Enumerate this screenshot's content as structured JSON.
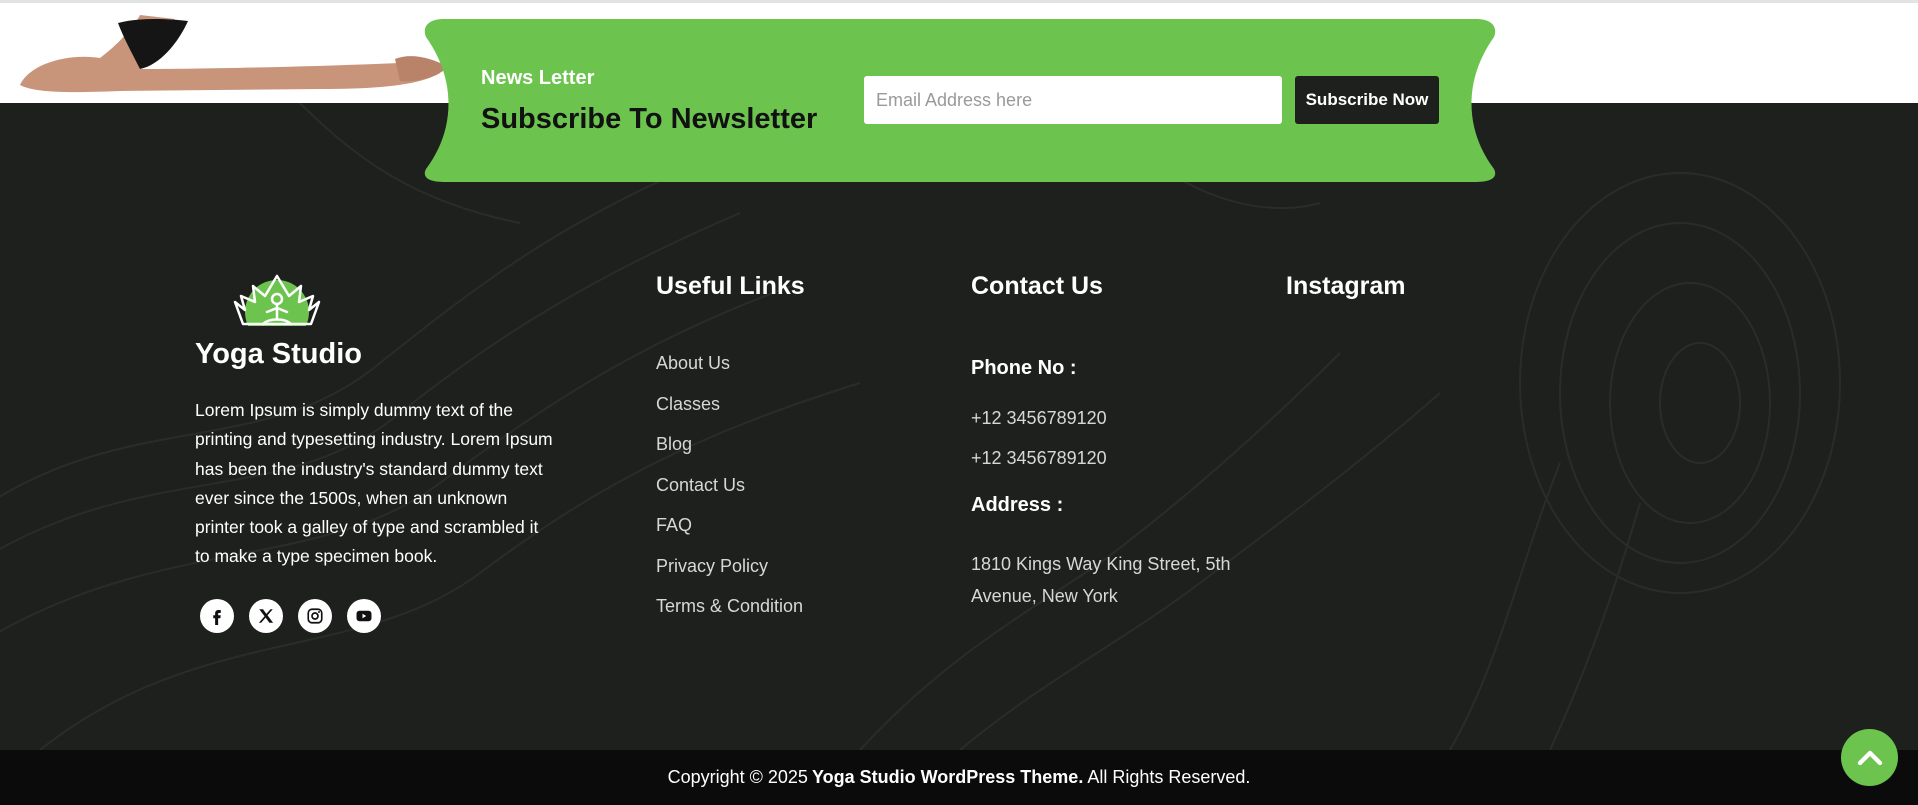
{
  "newsletter": {
    "kicker": "News Letter",
    "title": "Subscribe To Newsletter",
    "email_placeholder": "Email Address here",
    "button_label": "Subscribe Now"
  },
  "brand": {
    "name": "Yoga Studio"
  },
  "about": {
    "text": "Lorem Ipsum is simply dummy text of the printing and typesetting industry. Lorem Ipsum has been the industry's standard dummy text ever since the 1500s, when an unknown printer took a galley of type and scrambled it to make a type specimen book."
  },
  "socials": [
    {
      "icon": "facebook-icon"
    },
    {
      "icon": "x-twitter-icon"
    },
    {
      "icon": "instagram-icon"
    },
    {
      "icon": "youtube-icon"
    }
  ],
  "useful_links": {
    "title": "Useful Links",
    "items": [
      "About Us",
      "Classes",
      "Blog",
      "Contact Us",
      "FAQ",
      "Privacy Policy",
      "Terms & Condition"
    ]
  },
  "contact": {
    "title": "Contact Us",
    "phone_label": "Phone No :",
    "phones": [
      "+12 3456789120",
      "+12 3456789120"
    ],
    "address_label": "Address :",
    "address": "1810 Kings Way King Street, 5th Avenue, New York"
  },
  "instagram": {
    "title": "Instagram"
  },
  "copyright": {
    "prefix": "Copyright © 2025",
    "brand": "Yoga Studio WordPress Theme.",
    "suffix": "All Rights Reserved."
  },
  "colors": {
    "accent": "#6cc44f",
    "footer_bg": "#1e201e",
    "copyright_bg": "#0b0b0b"
  },
  "scroll_top": {
    "icon": "chevron-up-icon"
  }
}
